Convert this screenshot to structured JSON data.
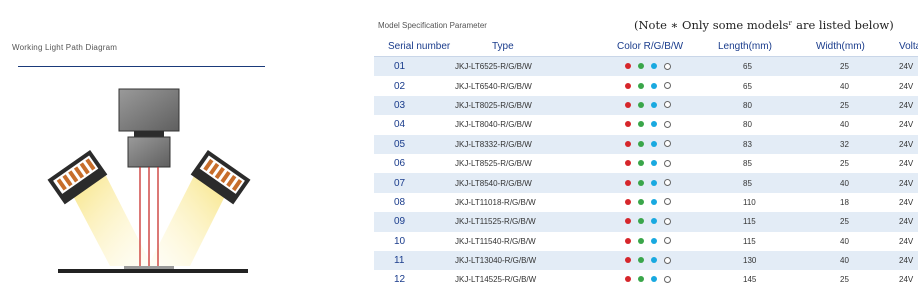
{
  "left": {
    "title": "Working Light Path Diagram"
  },
  "right": {
    "title": "Model Specification Parameter",
    "note": "(Note ∗ Only some modelsʳ are listed below)"
  },
  "colors": {
    "red": "#d6262b",
    "green": "#3aa64a",
    "blue": "#19a9e0",
    "white_outline": "#666666",
    "accent": "#1a3c8c",
    "stripe": "#e3ecf6"
  },
  "table": {
    "headers": [
      "Serial number",
      "Type",
      "Color R/G/B/W",
      "Length(mm)",
      "Width(mm)",
      "Voltage"
    ],
    "rows": [
      {
        "serial": "01",
        "type": "JKJ-LT6525-R/G/B/W",
        "length": "65",
        "width": "25",
        "voltage": "24V"
      },
      {
        "serial": "02",
        "type": "JKJ-LT6540-R/G/B/W",
        "length": "65",
        "width": "40",
        "voltage": "24V"
      },
      {
        "serial": "03",
        "type": "JKJ-LT8025-R/G/B/W",
        "length": "80",
        "width": "25",
        "voltage": "24V"
      },
      {
        "serial": "04",
        "type": "JKJ-LT8040-R/G/B/W",
        "length": "80",
        "width": "40",
        "voltage": "24V"
      },
      {
        "serial": "05",
        "type": "JKJ-LT8332-R/G/B/W",
        "length": "83",
        "width": "32",
        "voltage": "24V"
      },
      {
        "serial": "06",
        "type": "JKJ-LT8525-R/G/B/W",
        "length": "85",
        "width": "25",
        "voltage": "24V"
      },
      {
        "serial": "07",
        "type": "JKJ-LT8540-R/G/B/W",
        "length": "85",
        "width": "40",
        "voltage": "24V"
      },
      {
        "serial": "08",
        "type": "JKJ-LT11018-R/G/B/W",
        "length": "110",
        "width": "18",
        "voltage": "24V"
      },
      {
        "serial": "09",
        "type": "JKJ-LT11525-R/G/B/W",
        "length": "115",
        "width": "25",
        "voltage": "24V"
      },
      {
        "serial": "10",
        "type": "JKJ-LT11540-R/G/B/W",
        "length": "115",
        "width": "40",
        "voltage": "24V"
      },
      {
        "serial": "11",
        "type": "JKJ-LT13040-R/G/B/W",
        "length": "130",
        "width": "40",
        "voltage": "24V"
      },
      {
        "serial": "12",
        "type": "JKJ-LT14525-R/G/B/W",
        "length": "145",
        "width": "25",
        "voltage": "24V"
      }
    ]
  }
}
